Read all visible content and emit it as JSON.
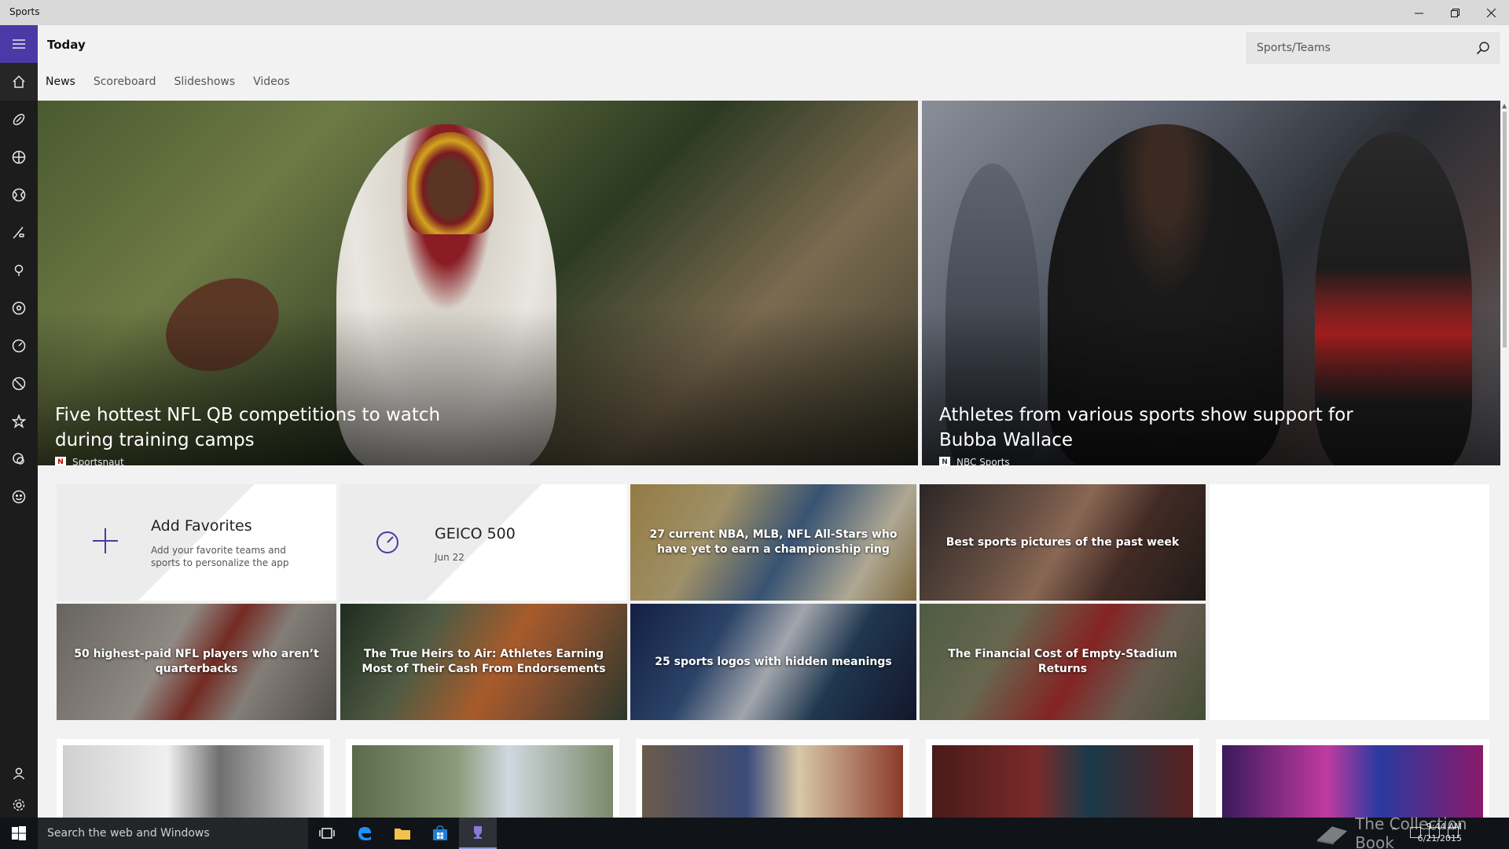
{
  "window": {
    "title": "Sports",
    "minimize_icon": "minimize-icon",
    "maximize_icon": "restore-icon",
    "close_icon": "close-icon"
  },
  "header": {
    "page_title": "Today",
    "search_placeholder": "Sports/Teams",
    "tabs": [
      {
        "label": "News",
        "active": true
      },
      {
        "label": "Scoreboard",
        "active": false
      },
      {
        "label": "Slideshows",
        "active": false
      },
      {
        "label": "Videos",
        "active": false
      }
    ]
  },
  "nav": {
    "items": [
      "menu-icon",
      "home-icon",
      "football-icon",
      "basketball-icon",
      "baseball-icon",
      "hockey-icon",
      "golf-icon",
      "soccer-icon",
      "racing-icon",
      "tennis-icon",
      "star-icon",
      "sports-list-icon",
      "fantasy-icon",
      "account-icon",
      "settings-icon"
    ],
    "accent": "#4b3aa5"
  },
  "hero": [
    {
      "caption": "Five hottest NFL QB competitions to watch during training camps",
      "source": "Sportsnaut"
    },
    {
      "caption": "Athletes from various sports show support for Bubba Wallace",
      "source": "NBC Sports"
    }
  ],
  "tiles": {
    "add_favorites": {
      "title": "Add Favorites",
      "description": "Add your favorite teams and sports to personalize the app"
    },
    "event": {
      "title": "GEICO 500",
      "date": "Jun 22"
    },
    "stories": [
      "27 current NBA, MLB, NFL All-Stars who have yet to earn a championship ring",
      "Best sports pictures of the past week",
      "50 highest-paid NFL players who aren’t quarterbacks",
      "The True Heirs to Air: Athletes Earning Most of Their Cash From Endorsements",
      "25 sports logos with hidden meanings",
      "The Financial Cost of Empty-Stadium Returns"
    ]
  },
  "taskbar": {
    "search_placeholder": "Search the web and Windows",
    "time": "9:44 AM",
    "date": "6/21/2015",
    "watermark": "The Collection Book"
  }
}
